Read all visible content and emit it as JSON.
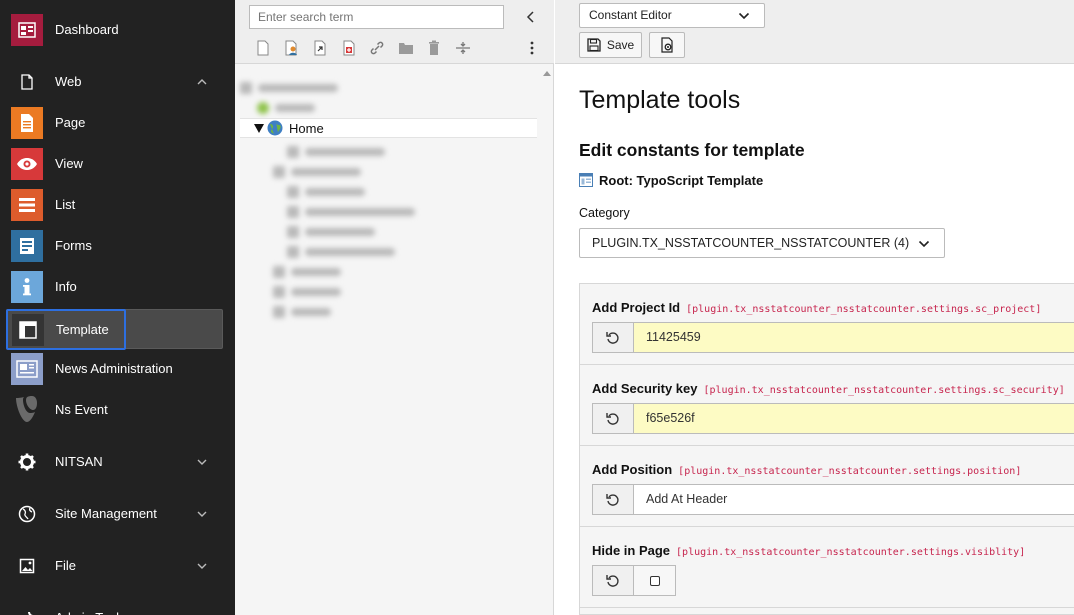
{
  "module_menu": {
    "items": [
      {
        "label": "Dashboard",
        "icon": "dashboard-icon",
        "color": "#a51c3e"
      },
      {
        "label": "Web",
        "icon": "web-page-icon",
        "group": true
      },
      {
        "label": "Page",
        "icon": "page-module-icon",
        "color": "#eb7a23"
      },
      {
        "label": "View",
        "icon": "eye-icon",
        "color": "#d7393a"
      },
      {
        "label": "List",
        "icon": "list-icon",
        "color": "#dd5c2c"
      },
      {
        "label": "Forms",
        "icon": "forms-icon",
        "color": "#2f6f9f"
      },
      {
        "label": "Info",
        "icon": "info-icon",
        "color": "#6ca7da"
      },
      {
        "label": "Template",
        "icon": "template-icon",
        "color": "#343434",
        "active": true
      },
      {
        "label": "News Administration",
        "icon": "news-icon",
        "color": "#8c9ec9"
      },
      {
        "label": "Ns Event",
        "icon": "typo3-logo-icon",
        "color": "#5b5b5b"
      },
      {
        "label": "NITSAN",
        "icon": "gear-icon",
        "group": true
      },
      {
        "label": "Site Management",
        "icon": "globe-icon",
        "group": true
      },
      {
        "label": "File",
        "icon": "image-icon",
        "group": true
      },
      {
        "label": "Admin Tools",
        "icon": "tools-icon",
        "group": true
      }
    ]
  },
  "page_tree": {
    "search_placeholder": "Enter search term",
    "home_label": "Home"
  },
  "docheader": {
    "module_select": "Constant Editor",
    "save_label": "Save"
  },
  "content": {
    "title": "Template tools",
    "subtitle": "Edit constants for template",
    "template_name": "Root: TypoScript Template",
    "category_label": "Category",
    "category_value": "PLUGIN.TX_NSSTATCOUNTER_NSSTATCOUNTER (4)",
    "constants": [
      {
        "label": "Add Project Id",
        "key": "[plugin.tx_nsstatcounter_nsstatcounter.settings.sc_project]",
        "value": "11425459",
        "type": "text",
        "changed": true
      },
      {
        "label": "Add Security key",
        "key": "[plugin.tx_nsstatcounter_nsstatcounter.settings.sc_security]",
        "value": "f65e526f",
        "type": "text",
        "changed": true
      },
      {
        "label": "Add Position",
        "key": "[plugin.tx_nsstatcounter_nsstatcounter.settings.position]",
        "value": "Add At Header",
        "type": "text",
        "changed": false
      },
      {
        "label": "Hide in Page",
        "key": "[plugin.tx_nsstatcounter_nsstatcounter.settings.visiblity]",
        "value": "",
        "type": "checkbox",
        "changed": false
      }
    ]
  },
  "colors": {
    "menu_bg": "#222222",
    "changed_field": "#fdfbc4",
    "constant_key": "#c7254e",
    "focus": "#2d6fe0"
  }
}
